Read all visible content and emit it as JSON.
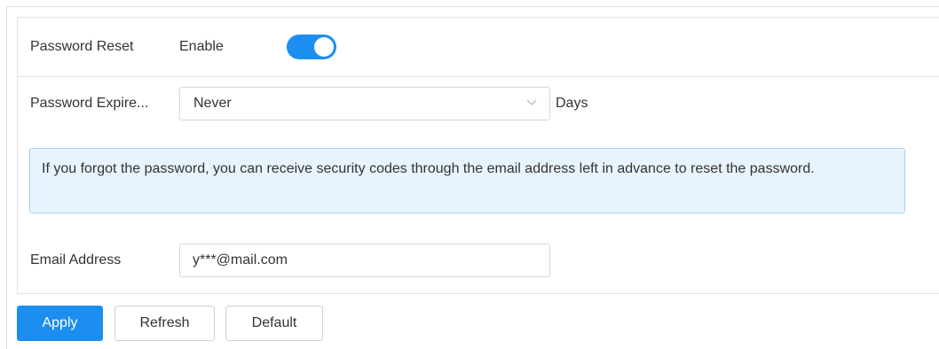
{
  "password_reset": {
    "label": "Password Reset",
    "enable_label": "Enable",
    "enabled": true,
    "toggle_color": "#1b8ef0"
  },
  "password_expire": {
    "label": "Password Expire...",
    "selected": "Never",
    "unit": "Days"
  },
  "info": {
    "text": "If you forgot the password, you can receive security codes through the email address left in advance to reset the password.",
    "background": "#e8f4fd",
    "border": "#a6d3f5"
  },
  "email": {
    "label": "Email Address",
    "value": "y***@mail.com"
  },
  "buttons": {
    "apply": "Apply",
    "refresh": "Refresh",
    "default": "Default"
  },
  "colors": {
    "accent": "#1b8ef0"
  }
}
